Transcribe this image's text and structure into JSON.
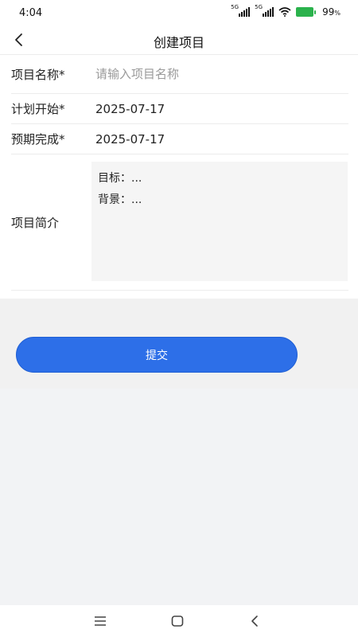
{
  "status": {
    "time": "4:04",
    "signal1": "5G",
    "signal2": "5G",
    "battery": "99",
    "battery_unit": "%"
  },
  "header": {
    "title": "创建项目"
  },
  "form": {
    "name_label": "项目名称*",
    "name_placeholder": "请输入项目名称",
    "start_label": "计划开始*",
    "start_value": "2025-07-17",
    "end_label": "预期完成*",
    "end_value": "2025-07-17",
    "intro_label": "项目简介",
    "intro_line1": "目标：...",
    "intro_line2": "背景：..."
  },
  "submit_label": "提交",
  "icons": {
    "back": "chevron-left-icon",
    "menu": "menu-icon",
    "home": "home-icon",
    "nav_back": "back-icon"
  },
  "colors": {
    "accent": "#2d6fe8",
    "battery": "#2bb24c"
  }
}
